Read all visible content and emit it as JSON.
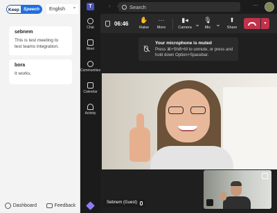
{
  "left_panel": {
    "logo_keep": "Keep",
    "logo_speech": "Speech",
    "language": "English",
    "messages": [
      {
        "author": "sebnem",
        "text": "This is test meeting to test teams integration."
      },
      {
        "author": "bora",
        "text": "It works."
      }
    ],
    "footer": {
      "dashboard": "Dashboard",
      "feedback": "Feedback"
    }
  },
  "rail": {
    "items": [
      "Chat",
      "Meet",
      "Communities",
      "Calendar",
      "Activity"
    ]
  },
  "topbar": {
    "search_label": "Search",
    "more": "···"
  },
  "meeting_bar": {
    "timer": "06:46",
    "buttons": {
      "raise": "Raise",
      "more": "More",
      "camera": "Camera",
      "mic": "Mic",
      "share": "Share"
    }
  },
  "toast": {
    "title": "Your microphone is muted",
    "body": "Press ⌘+Shift+M to unmute, or press and hold down Option+Spacebar."
  },
  "stage": {
    "participant_name": "Sebnem (Guest)"
  },
  "colors": {
    "hangup": "#c4314b",
    "teams_purple": "#4b53bc",
    "keep_blue": "#1f6fe0"
  }
}
